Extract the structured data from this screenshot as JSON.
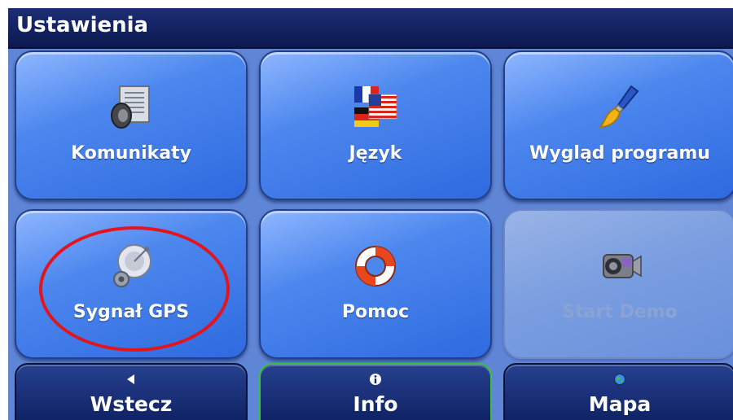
{
  "header": {
    "title": "Ustawienia"
  },
  "tiles": [
    {
      "label": "Komunikaty",
      "icon": "speaker-icon",
      "enabled": true
    },
    {
      "label": "Język",
      "icon": "flags-icon",
      "enabled": true
    },
    {
      "label": "Wygląd programu",
      "icon": "paintbrush-icon",
      "enabled": true
    },
    {
      "label": "Sygnał GPS",
      "icon": "satellite-dish-icon",
      "enabled": true
    },
    {
      "label": "Pomoc",
      "icon": "lifebuoy-icon",
      "enabled": true
    },
    {
      "label": "Start Demo",
      "icon": "video-camera-icon",
      "enabled": false
    }
  ],
  "nav": [
    {
      "label": "Wstecz",
      "icon": "back-arrow-icon"
    },
    {
      "label": "Info",
      "icon": "info-icon",
      "active": true
    },
    {
      "label": "Mapa",
      "icon": "globe-icon"
    }
  ],
  "colors": {
    "screen_bg": "#5f86d6",
    "titlebar": "#14246a",
    "highlight": "#e4141d",
    "active_border": "#3fbf3f"
  }
}
